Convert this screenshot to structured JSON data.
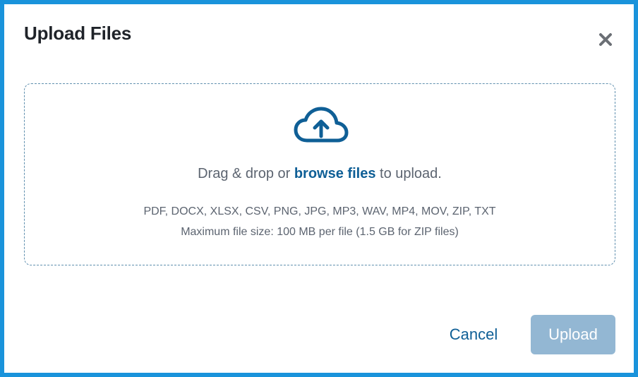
{
  "dialog": {
    "title": "Upload Files",
    "close_icon": "close-icon"
  },
  "dropzone": {
    "icon": "cloud-upload-icon",
    "text_before": "Drag & drop or ",
    "browse_label": "browse files",
    "text_after": " to upload.",
    "file_types": "PDF, DOCX, XLSX, CSV, PNG, JPG, MP3, WAV, MP4, MOV, ZIP, TXT",
    "max_size": "Maximum file size: 100 MB per file (1.5 GB for ZIP files)"
  },
  "footer": {
    "cancel_label": "Cancel",
    "upload_label": "Upload",
    "upload_disabled": true
  },
  "colors": {
    "frame_border": "#1a93db",
    "accent": "#0f5f96",
    "upload_disabled_bg": "#93b7d3",
    "dropzone_border": "#5f8fae"
  }
}
